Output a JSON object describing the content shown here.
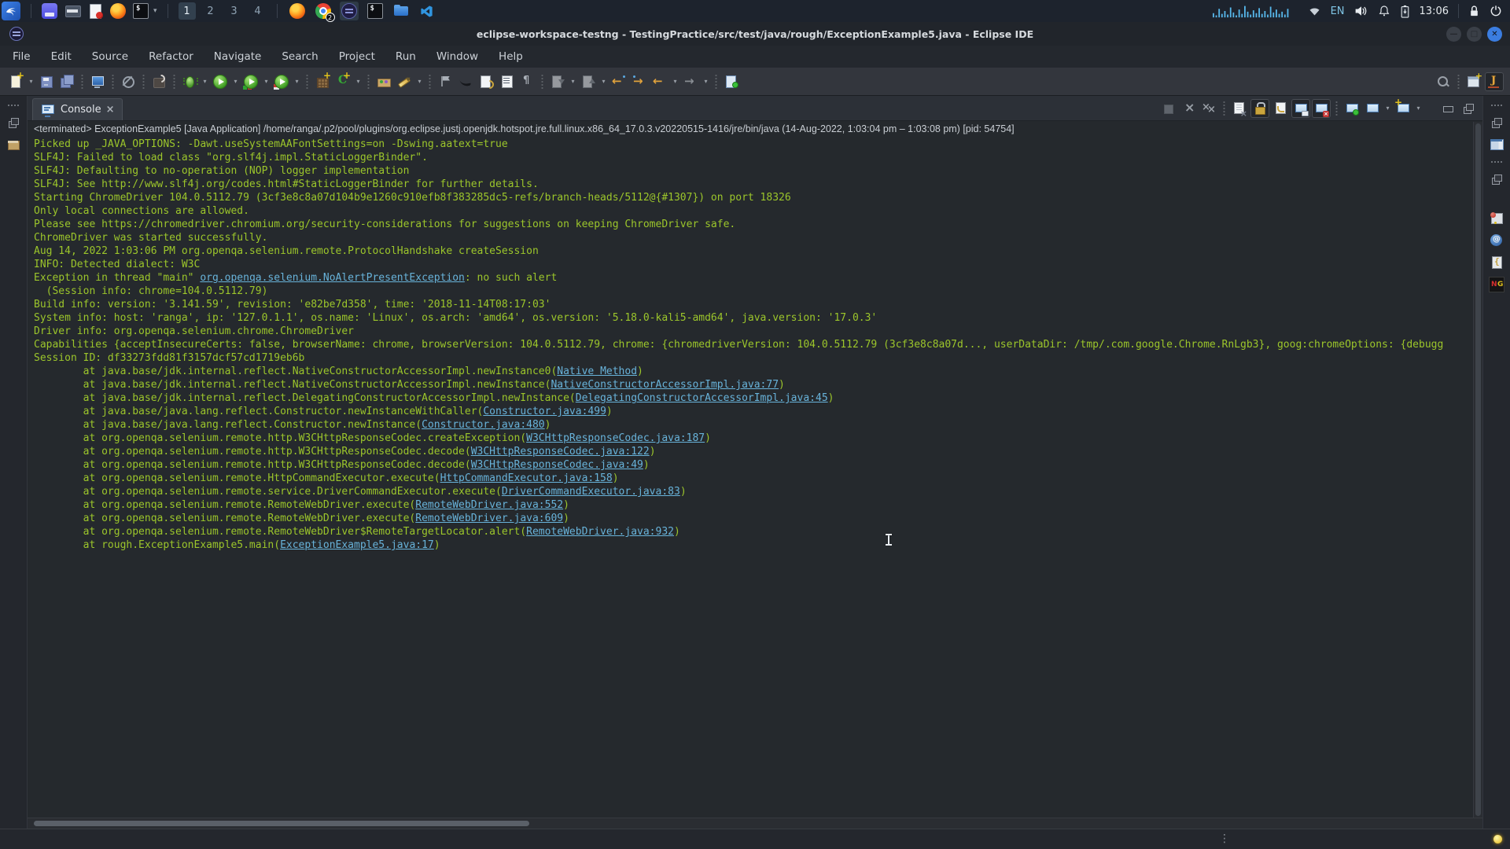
{
  "taskbar": {
    "launchers": [
      "kali-menu",
      "file-manager",
      "folder",
      "text-editor",
      "firefox",
      "terminal"
    ],
    "workspaces": {
      "items": [
        "1",
        "2",
        "3",
        "4"
      ],
      "active": "1"
    },
    "apps": [
      "firefox",
      "chrome",
      "eclipse",
      "terminal",
      "files",
      "vscode"
    ],
    "chrome_badge": "2",
    "tray": {
      "language": "EN",
      "clock": "13:06"
    }
  },
  "window": {
    "title": "eclipse-workspace-testng - TestingPractice/src/test/java/rough/ExceptionExample5.java - Eclipse IDE"
  },
  "menubar": [
    "File",
    "Edit",
    "Source",
    "Refactor",
    "Navigate",
    "Search",
    "Project",
    "Run",
    "Window",
    "Help"
  ],
  "toolbar": [
    {
      "icon": "new-wizard",
      "dropdown": true
    },
    {
      "icon": "save"
    },
    {
      "icon": "save-all"
    },
    {
      "sep": true
    },
    {
      "icon": "terminal-view"
    },
    {
      "sep": true
    },
    {
      "icon": "skip-breakpoints"
    },
    {
      "sep": true
    },
    {
      "icon": "task-repo"
    },
    {
      "sep": true
    },
    {
      "icon": "debug",
      "dropdown": true
    },
    {
      "icon": "run",
      "dropdown": true
    },
    {
      "icon": "coverage",
      "dropdown": true
    },
    {
      "icon": "profile",
      "dropdown": true
    },
    {
      "sep": true
    },
    {
      "icon": "new-java-project"
    },
    {
      "icon": "new-java-class",
      "dropdown": true
    },
    {
      "sep": true
    },
    {
      "icon": "open-type"
    },
    {
      "icon": "search-marker",
      "dropdown": true
    },
    {
      "sep": true
    },
    {
      "icon": "flag"
    },
    {
      "icon": "last-edit"
    },
    {
      "icon": "doc-refresh"
    },
    {
      "icon": "grid-doc"
    },
    {
      "icon": "pilcrow"
    },
    {
      "sep": true
    },
    {
      "icon": "annot-next",
      "dropdown": true,
      "disabled": true
    },
    {
      "icon": "annot-prev",
      "dropdown": true,
      "disabled": true
    },
    {
      "icon": "prev-edit"
    },
    {
      "icon": "next-edit"
    },
    {
      "icon": "back",
      "dropdown": true
    },
    {
      "icon": "forward",
      "dropdown": true,
      "disabled": true
    },
    {
      "sep": true
    },
    {
      "icon": "pin-editor"
    },
    {
      "spacer": true
    },
    {
      "icon": "search-lens"
    },
    {
      "sep": true
    },
    {
      "icon": "open-perspective"
    },
    {
      "icon": "java-perspective",
      "pressed": true
    }
  ],
  "console": {
    "tab_label": "Console",
    "toolbar": [
      {
        "icon": "terminate",
        "disabled": true
      },
      {
        "icon": "remove-launch"
      },
      {
        "icon": "remove-all-terminated"
      },
      {
        "sep": true
      },
      {
        "icon": "clear-console"
      },
      {
        "icon": "scroll-lock",
        "pressed": true
      },
      {
        "icon": "word-wrap"
      },
      {
        "icon": "show-stdout",
        "pressed": true
      },
      {
        "icon": "show-stderr",
        "pressed": true
      },
      {
        "sep": true
      },
      {
        "icon": "pin-console"
      },
      {
        "icon": "display-console",
        "dropdown": true
      },
      {
        "icon": "open-console",
        "dropdown": true
      },
      {
        "gap": true
      },
      {
        "icon": "minimize-view"
      },
      {
        "icon": "restore-view"
      }
    ],
    "terminated_line": "<terminated> ExceptionExample5 [Java Application] /home/ranga/.p2/pool/plugins/org.eclipse.justj.openjdk.hotspot.jre.full.linux.x86_64_17.0.3.v20220515-1416/jre/bin/java (14-Aug-2022, 1:03:04 pm – 1:03:08 pm) [pid: 54754]",
    "lines": [
      [
        [
          "t",
          "Picked up _JAVA_OPTIONS: -Dawt.useSystemAAFontSettings=on -Dswing.aatext=true"
        ]
      ],
      [
        [
          "t",
          "SLF4J: Failed to load class \"org.slf4j.impl.StaticLoggerBinder\"."
        ]
      ],
      [
        [
          "t",
          "SLF4J: Defaulting to no-operation (NOP) logger implementation"
        ]
      ],
      [
        [
          "t",
          "SLF4J: See http://www.slf4j.org/codes.html#StaticLoggerBinder for further details."
        ]
      ],
      [
        [
          "t",
          "Starting ChromeDriver 104.0.5112.79 (3cf3e8c8a07d104b9e1260c910efb8f383285dc5-refs/branch-heads/5112@{#1307}) on port 18326"
        ]
      ],
      [
        [
          "t",
          "Only local connections are allowed."
        ]
      ],
      [
        [
          "t",
          "Please see https://chromedriver.chromium.org/security-considerations for suggestions on keeping ChromeDriver safe."
        ]
      ],
      [
        [
          "t",
          "ChromeDriver was started successfully."
        ]
      ],
      [
        [
          "t",
          "Aug 14, 2022 1:03:06 PM org.openqa.selenium.remote.ProtocolHandshake createSession"
        ]
      ],
      [
        [
          "t",
          "INFO: Detected dialect: W3C"
        ]
      ],
      [
        [
          "t",
          "Exception in thread \"main\" "
        ],
        [
          "l",
          "org.openqa.selenium.NoAlertPresentException"
        ],
        [
          "t",
          ": no such alert"
        ]
      ],
      [
        [
          "t",
          "  (Session info: chrome=104.0.5112.79)"
        ]
      ],
      [
        [
          "t",
          "Build info: version: '3.141.59', revision: 'e82be7d358', time: '2018-11-14T08:17:03'"
        ]
      ],
      [
        [
          "t",
          "System info: host: 'ranga', ip: '127.0.1.1', os.name: 'Linux', os.arch: 'amd64', os.version: '5.18.0-kali5-amd64', java.version: '17.0.3'"
        ]
      ],
      [
        [
          "t",
          "Driver info: org.openqa.selenium.chrome.ChromeDriver"
        ]
      ],
      [
        [
          "t",
          "Capabilities {acceptInsecureCerts: false, browserName: chrome, browserVersion: 104.0.5112.79, chrome: {chromedriverVersion: 104.0.5112.79 (3cf3e8c8a07d..., userDataDir: /tmp/.com.google.Chrome.RnLgb3}, goog:chromeOptions: {debugg"
        ]
      ],
      [
        [
          "t",
          "Session ID: df33273fdd81f3157dcf57cd1719eb6b"
        ]
      ],
      [
        [
          "t",
          "        at java.base/jdk.internal.reflect.NativeConstructorAccessorImpl.newInstance0("
        ],
        [
          "l",
          "Native Method"
        ],
        [
          "t",
          ")"
        ]
      ],
      [
        [
          "t",
          "        at java.base/jdk.internal.reflect.NativeConstructorAccessorImpl.newInstance("
        ],
        [
          "l",
          "NativeConstructorAccessorImpl.java:77"
        ],
        [
          "t",
          ")"
        ]
      ],
      [
        [
          "t",
          "        at java.base/jdk.internal.reflect.DelegatingConstructorAccessorImpl.newInstance("
        ],
        [
          "l",
          "DelegatingConstructorAccessorImpl.java:45"
        ],
        [
          "t",
          ")"
        ]
      ],
      [
        [
          "t",
          "        at java.base/java.lang.reflect.Constructor.newInstanceWithCaller("
        ],
        [
          "l",
          "Constructor.java:499"
        ],
        [
          "t",
          ")"
        ]
      ],
      [
        [
          "t",
          "        at java.base/java.lang.reflect.Constructor.newInstance("
        ],
        [
          "l",
          "Constructor.java:480"
        ],
        [
          "t",
          ")"
        ]
      ],
      [
        [
          "t",
          "        at org.openqa.selenium.remote.http.W3CHttpResponseCodec.createException("
        ],
        [
          "l",
          "W3CHttpResponseCodec.java:187"
        ],
        [
          "t",
          ")"
        ]
      ],
      [
        [
          "t",
          "        at org.openqa.selenium.remote.http.W3CHttpResponseCodec.decode("
        ],
        [
          "l",
          "W3CHttpResponseCodec.java:122"
        ],
        [
          "t",
          ")"
        ]
      ],
      [
        [
          "t",
          "        at org.openqa.selenium.remote.http.W3CHttpResponseCodec.decode("
        ],
        [
          "l",
          "W3CHttpResponseCodec.java:49"
        ],
        [
          "t",
          ")"
        ]
      ],
      [
        [
          "t",
          "        at org.openqa.selenium.remote.HttpCommandExecutor.execute("
        ],
        [
          "l",
          "HttpCommandExecutor.java:158"
        ],
        [
          "t",
          ")"
        ]
      ],
      [
        [
          "t",
          "        at org.openqa.selenium.remote.service.DriverCommandExecutor.execute("
        ],
        [
          "l",
          "DriverCommandExecutor.java:83"
        ],
        [
          "t",
          ")"
        ]
      ],
      [
        [
          "t",
          "        at org.openqa.selenium.remote.RemoteWebDriver.execute("
        ],
        [
          "l",
          "RemoteWebDriver.java:552"
        ],
        [
          "t",
          ")"
        ]
      ],
      [
        [
          "t",
          "        at org.openqa.selenium.remote.RemoteWebDriver.execute("
        ],
        [
          "l",
          "RemoteWebDriver.java:609"
        ],
        [
          "t",
          ")"
        ]
      ],
      [
        [
          "t",
          "        at org.openqa.selenium.remote.RemoteWebDriver$RemoteTargetLocator.alert("
        ],
        [
          "l",
          "RemoteWebDriver.java:932"
        ],
        [
          "t",
          ")"
        ]
      ],
      [
        [
          "t",
          "        at rough.ExceptionExample5.main("
        ],
        [
          "l",
          "ExceptionExample5.java:17"
        ],
        [
          "t",
          ")"
        ]
      ]
    ]
  },
  "left_trim": [
    "trim-dots",
    "trim-restore",
    "package-explorer"
  ],
  "right_trim": [
    "trim-dots",
    "trim-restore",
    "editor-area",
    "trim-dots",
    "trim-restore",
    "view-window-red",
    "javadoc-view",
    "declaration-view",
    "testng-view"
  ],
  "colors": {
    "console_text": "#9cc62b",
    "console_link": "#68b3da",
    "console_bg": "#25292d",
    "terminated_text": "#c9ced4",
    "taskbar_bg": "#1d232d",
    "toolbar_bg": "#33363d",
    "close_button": "#3b7de0"
  }
}
